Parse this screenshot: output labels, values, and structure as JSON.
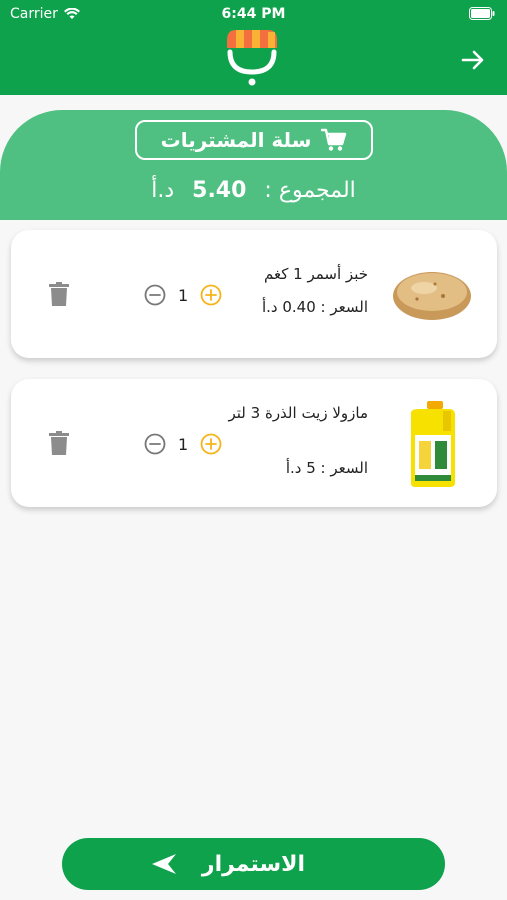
{
  "status_bar": {
    "carrier": "Carrier",
    "time": "6:44 PM"
  },
  "colors": {
    "primary_green": "#0fa24c",
    "light_green": "#4fc081",
    "accent_orange": "#f6b417"
  },
  "icons": {
    "status": [
      "wifi-icon",
      "battery-icon"
    ],
    "header": [
      "store-logo-icon",
      "arrow-right-icon"
    ],
    "cart": "shopping-cart-icon",
    "item": [
      "minus-circle-icon",
      "plus-circle-icon",
      "trash-icon"
    ],
    "continue": "arrow-left-icon"
  },
  "cart": {
    "title": "سلة المشتريات",
    "total_label": "المجموع :",
    "total_value": "5.40",
    "currency": "د.أ"
  },
  "items": [
    {
      "name": "خبز أسمر 1 كغم",
      "price": "السعر : 0.40 د.أ",
      "quantity": "1",
      "image": "bread"
    },
    {
      "name": "مازولا زيت الذرة 3 لتر",
      "price": "السعر : 5 د.أ",
      "quantity": "1",
      "image": "corn-oil-bottle"
    }
  ],
  "continue_button": {
    "label": "الاستمرار"
  }
}
